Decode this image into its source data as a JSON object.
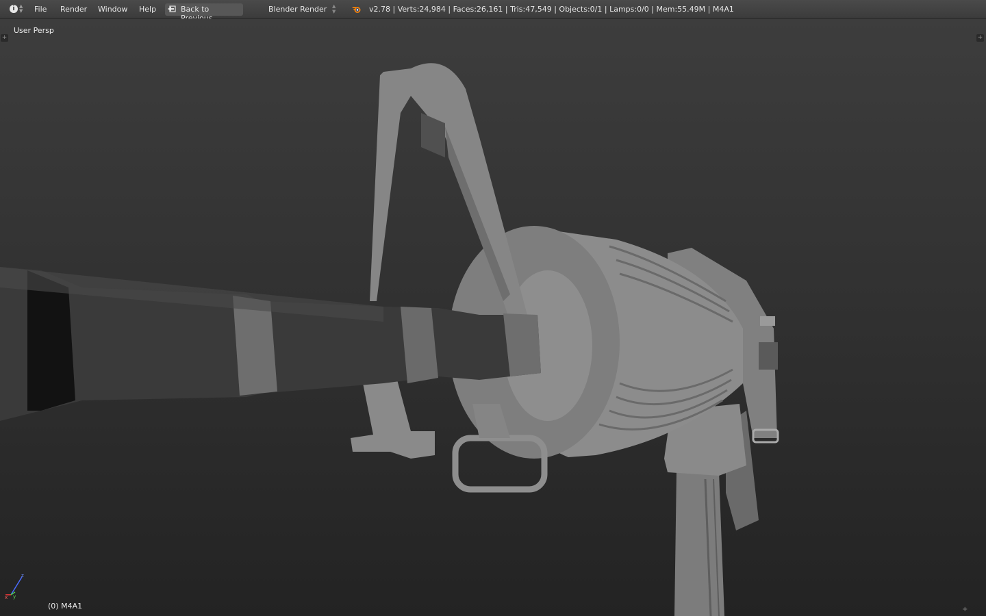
{
  "topbar": {
    "info_icon": "info-icon",
    "menus": [
      {
        "label": "File"
      },
      {
        "label": "Render"
      },
      {
        "label": "Window"
      },
      {
        "label": "Help"
      }
    ],
    "back_label": "Back to Previous",
    "render_engine": "Blender Render",
    "logo_icon": "blender-logo-icon",
    "stats": "v2.78 | Verts:24,984 | Faces:26,161 | Tris:47,549 | Objects:0/1 | Lamps:0/0 | Mem:55.49M | M4A1"
  },
  "viewport": {
    "view_name": "User Persp",
    "object_info": "(0) M4A1"
  },
  "colors": {
    "header_bg": "#444444",
    "viewport_top": "#3d3d3d",
    "viewport_bottom": "#232323",
    "model_gray": "#7a7a7a",
    "barrel_dark": "#3a3a3a"
  }
}
